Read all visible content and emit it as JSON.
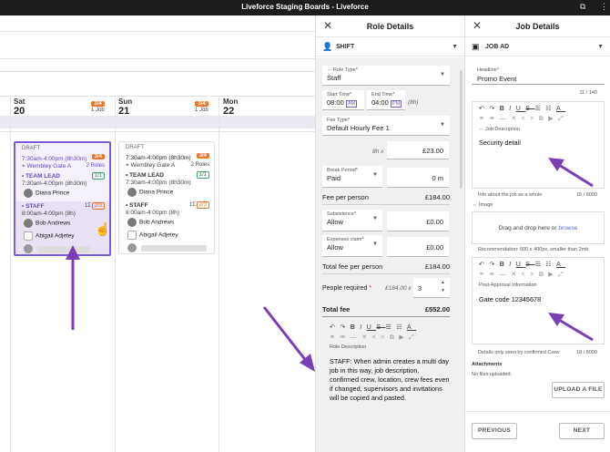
{
  "window": {
    "title": "Liveforce Staging Boards - Liveforce"
  },
  "board": {
    "days": [
      {
        "name": "Sat",
        "date": "20",
        "fill": "3/4",
        "jobs": "1 Job"
      },
      {
        "name": "Sun",
        "date": "21",
        "fill": "3/4",
        "jobs": "1 Job"
      },
      {
        "name": "Mon",
        "date": "22"
      }
    ],
    "cards": [
      {
        "status": "DRAFT",
        "time": "7:30am-4:00pm (8h30m)",
        "fill": "3/4",
        "location": "Wembley Gate A",
        "roles": "2 Roles",
        "team_lead": {
          "label": "• TEAM LEAD",
          "count": "1/1",
          "time": "7:30am-4:00pm (8h30m)",
          "person": "Diana Prince"
        },
        "staff": {
          "label": "• STAFF",
          "count": "2/3",
          "prefix": "1Σ",
          "time": "8:00am-4:00pm (8h)",
          "people": [
            "Bob Andrews",
            "Abigail Adjetey"
          ]
        }
      },
      {
        "status": "DRAFT",
        "time": "7:30am-4:00pm (8h30m)",
        "fill": "3/4",
        "location": "Wembley Gate A",
        "roles": "2 Roles",
        "team_lead": {
          "label": "• TEAM LEAD",
          "count": "1/1",
          "time": "7:30am-4:00pm (8h30m)",
          "person": "Diana Prince"
        },
        "staff": {
          "label": "• STAFF",
          "count": "2/3",
          "prefix": "1Σ",
          "time": "8:00am-4:00pm (8h)",
          "people": [
            "Bob Andrews",
            "Abigail Adjetey"
          ]
        }
      }
    ]
  },
  "role_panel": {
    "title": "Role Details",
    "section": "SHIFT",
    "role_type": {
      "label": "Role Type*",
      "value": "Staff"
    },
    "start_time": {
      "label": "Start Time*",
      "value": "08:00",
      "ampm": "AM"
    },
    "end_time": {
      "label": "End Time*",
      "value": "04:00",
      "ampm": "PM"
    },
    "duration": "(8h)",
    "fee_type": {
      "label": "Fee Type*",
      "value": "Default Hourly Fee 1"
    },
    "fee_hours": "8h x",
    "fee_amount": "£23.00",
    "break_period": {
      "label": "Break Period*",
      "value": "Paid",
      "minutes": "0 m"
    },
    "fee_per_person": {
      "label": "Fee per person",
      "value": "£184.00"
    },
    "subsistence": {
      "label": "Subsistence*",
      "value": "Allow",
      "amount": "£0.00"
    },
    "expenses": {
      "label": "Expenses claim*",
      "value": "Allow",
      "amount": "£0.00"
    },
    "total_fee_per_person": {
      "label": "Total fee per person",
      "value": "£184.00"
    },
    "people_required": {
      "label": "People required",
      "star": "*",
      "calc": "£184.00 x",
      "value": "3"
    },
    "total_fee": {
      "label": "Total fee",
      "value": "£552.00"
    },
    "editor_label": "Role Description",
    "description": "STAFF: When admin creates a multi day job in this way, job description, confirmed crew, location, crew fees even if changed, supervisors and invitations will be copied and pasted."
  },
  "job_panel": {
    "title": "Job Details",
    "section": "JOB AD",
    "headline": {
      "label": "Headline*",
      "value": "Promo Event",
      "counter": "11 / 140"
    },
    "description_label": "Job Description",
    "description": "Security detail",
    "description_note": "Info about the job as a whole",
    "description_counter": "15 / 8000",
    "image_label": "Image",
    "drop_text": "Drag and drop here or",
    "browse": "browse",
    "recommendation": "Recommendation: 600 x 400px, smaller than 2mb",
    "post_label": "Post-Approval Information",
    "post_text": "Gate code 12345678",
    "post_note": "Details only seen by confirmed Crew",
    "post_counter": "18 / 8000",
    "attachments_label": "Attachments",
    "attachments_empty": "No files uploaded.",
    "upload_button": "UPLOAD A FILE",
    "previous_button": "PREVIOUS",
    "next_button": "NEXT"
  },
  "colors": {
    "accent": "#7c5cd6",
    "orange": "#e8762d",
    "green": "#3aa76d",
    "link": "#5b6bd6"
  }
}
